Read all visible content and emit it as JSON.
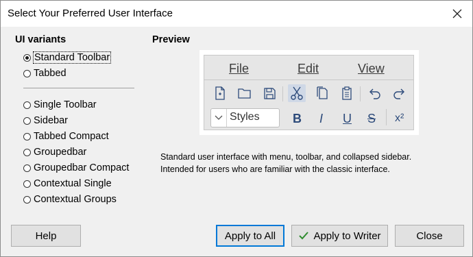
{
  "window": {
    "title": "Select Your Preferred User Interface"
  },
  "variants": {
    "heading": "UI variants",
    "group1": [
      {
        "label": "Standard Toolbar",
        "checked": true
      },
      {
        "label": "Tabbed",
        "checked": false
      }
    ],
    "group2": [
      {
        "label": "Single Toolbar",
        "checked": false
      },
      {
        "label": "Sidebar",
        "checked": false
      },
      {
        "label": "Tabbed Compact",
        "checked": false
      },
      {
        "label": "Groupedbar",
        "checked": false
      },
      {
        "label": "Groupedbar Compact",
        "checked": false
      },
      {
        "label": "Contextual Single",
        "checked": false
      },
      {
        "label": "Contextual Groups",
        "checked": false
      }
    ]
  },
  "preview": {
    "heading": "Preview",
    "menu": [
      "File",
      "Edit",
      "View"
    ],
    "styles_value": "Styles",
    "format_buttons": [
      "B",
      "I",
      "U",
      "S",
      "x²"
    ],
    "description_line1": "Standard user interface with menu, toolbar, and collapsed sidebar.",
    "description_line2": "Intended for users who are familiar with the classic interface."
  },
  "buttons": {
    "help": "Help",
    "apply_all": "Apply to All",
    "apply_writer": "Apply to Writer",
    "close": "Close"
  },
  "colors": {
    "accent": "#0078d7",
    "icon_blue": "#2c4a7a",
    "check_green": "#2e8b2e"
  }
}
